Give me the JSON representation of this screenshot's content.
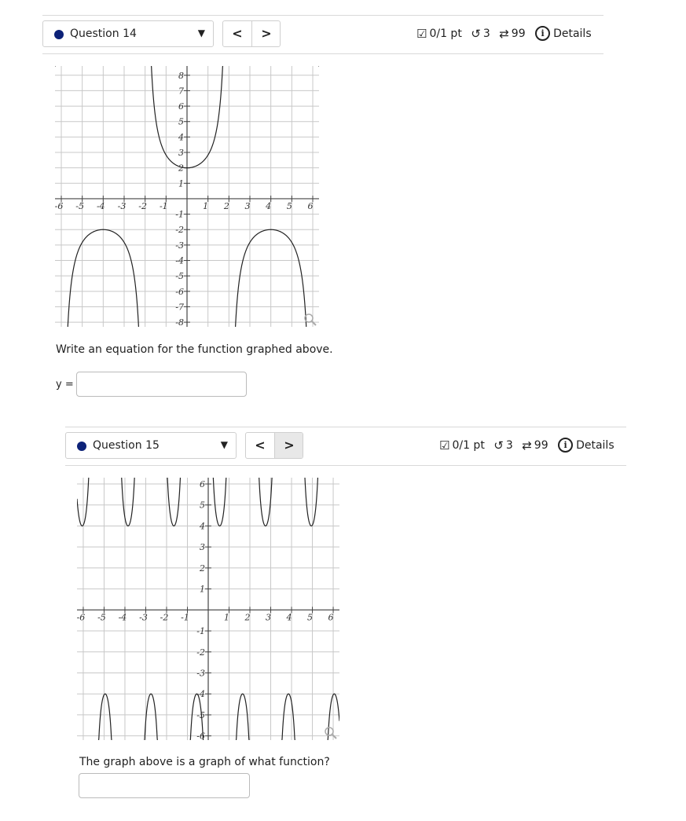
{
  "questions": [
    {
      "title": "Question 14",
      "points": "0/1 pt",
      "retries": "3",
      "attempts": "99",
      "details_label": "Details",
      "prompt": "Write an equation for the function graphed above.",
      "answer_label": "y =",
      "answer_value": "",
      "graph": {
        "x_ticks": [
          "-6",
          "-5",
          "-4",
          "-3",
          "-2",
          "-1",
          "1",
          "2",
          "3",
          "4",
          "5",
          "6"
        ],
        "y_ticks": [
          "8",
          "7",
          "6",
          "5",
          "4",
          "3",
          "2",
          "1",
          "-1",
          "-2",
          "-3",
          "-4",
          "-5",
          "-6",
          "-7",
          "-8"
        ]
      }
    },
    {
      "title": "Question 15",
      "points": "0/1 pt",
      "retries": "3",
      "attempts": "99",
      "details_label": "Details",
      "prompt": "The graph above is a graph of what function?",
      "answer_value": "",
      "graph": {
        "x_ticks": [
          "-6",
          "-5",
          "-4",
          "-3",
          "-2",
          "-1",
          "1",
          "2",
          "3",
          "4",
          "5",
          "6"
        ],
        "y_ticks": [
          "6",
          "5",
          "4",
          "3",
          "2",
          "1",
          "-1",
          "-2",
          "-3",
          "-4",
          "-5",
          "-6"
        ]
      }
    }
  ],
  "icons": {
    "checkbox": "checkbox-icon",
    "retry": "retry-icon",
    "attempts": "repeat-icon",
    "info": "info-icon",
    "zoom": "magnifier-icon"
  }
}
